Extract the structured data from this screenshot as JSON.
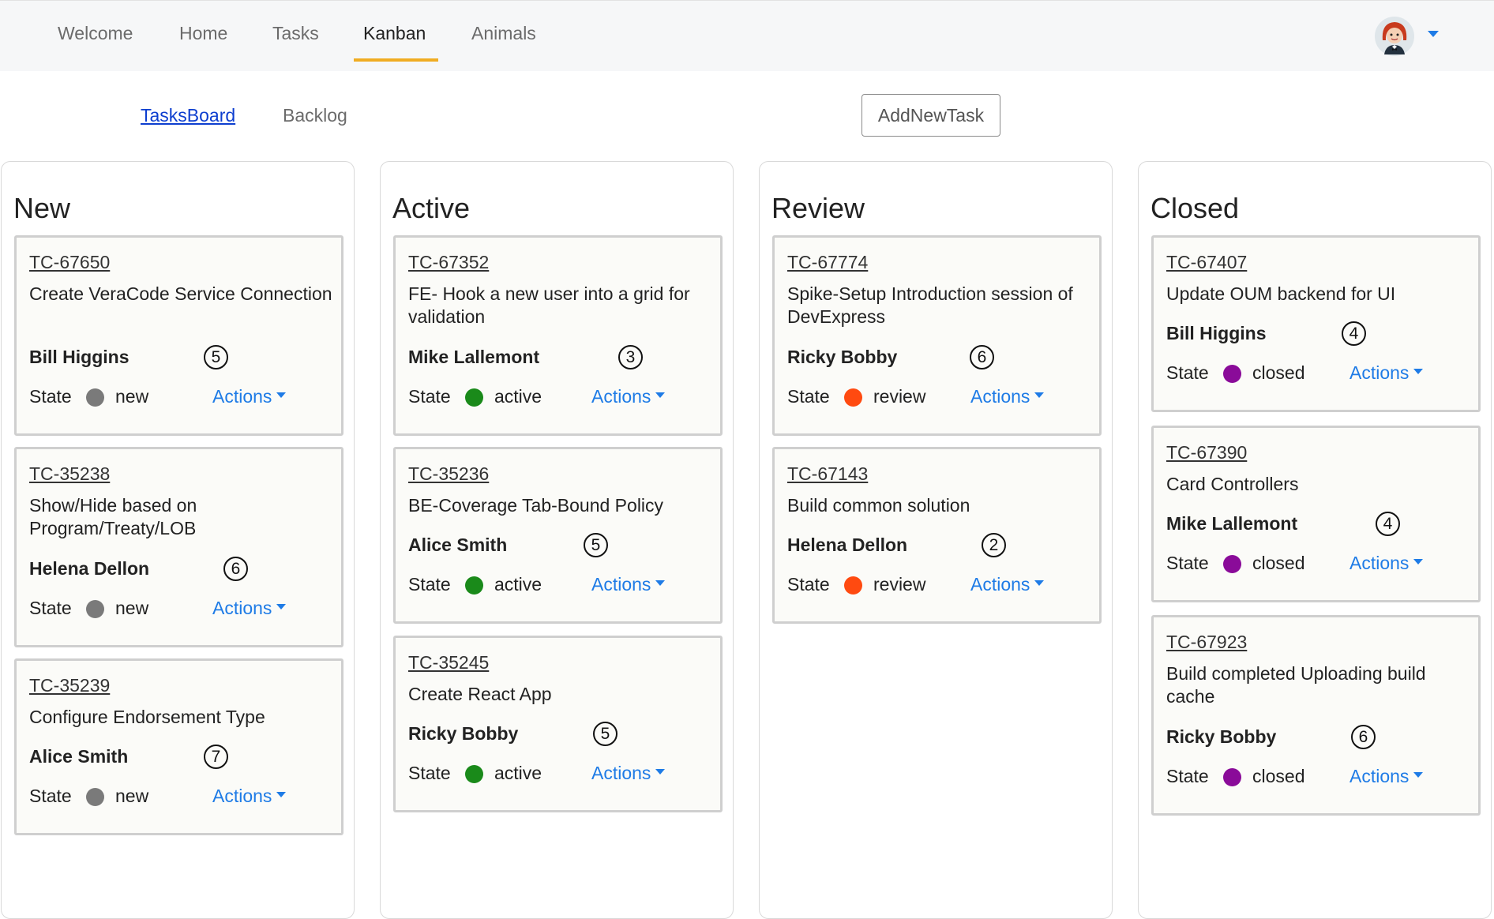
{
  "nav": {
    "links": [
      {
        "label": "Welcome",
        "active": false
      },
      {
        "label": "Home",
        "active": false
      },
      {
        "label": "Tasks",
        "active": false
      },
      {
        "label": "Kanban",
        "active": true
      },
      {
        "label": "Animals",
        "active": false
      }
    ],
    "accent_color": "#f0ad23",
    "avatar_icon": "user-avatar"
  },
  "subnav": {
    "taskboard_label": "TasksBoard",
    "backlog_label": "Backlog",
    "add_button_label": "AddNewTask"
  },
  "state_colors": {
    "new": "#7a7a7a",
    "active": "#1a8a1a",
    "review": "#ff4a10",
    "closed": "#8a0b99"
  },
  "columns": [
    {
      "title": "New",
      "cards": [
        {
          "id": "TC-67650",
          "title": "Create VeraCode Service Connection",
          "assignee": "Bill Higgins",
          "points": "5",
          "state_label": "State",
          "state": "new",
          "actions_label": "Actions"
        },
        {
          "id": "TC-35238",
          "title": "Show/Hide based on Program/Treaty/LOB",
          "assignee": "Helena Dellon",
          "points": "6",
          "state_label": "State",
          "state": "new",
          "actions_label": "Actions"
        },
        {
          "id": "TC-35239",
          "title": "Configure Endorsement Type",
          "assignee": "Alice Smith",
          "points": "7",
          "state_label": "State",
          "state": "new",
          "actions_label": "Actions"
        }
      ]
    },
    {
      "title": "Active",
      "cards": [
        {
          "id": "TC-67352",
          "title": "FE- Hook a new user into a grid for validation",
          "assignee": "Mike Lallemont",
          "points": "3",
          "state_label": "State",
          "state": "active",
          "actions_label": "Actions"
        },
        {
          "id": "TC-35236",
          "title": "BE-Coverage Tab-Bound Policy",
          "assignee": "Alice Smith",
          "points": "5",
          "state_label": "State",
          "state": "active",
          "actions_label": "Actions"
        },
        {
          "id": "TC-35245",
          "title": "Create React App",
          "assignee": "Ricky Bobby",
          "points": "5",
          "state_label": "State",
          "state": "active",
          "actions_label": "Actions"
        }
      ]
    },
    {
      "title": "Review",
      "cards": [
        {
          "id": "TC-67774",
          "title": "Spike-Setup Introduction session of DevExpress",
          "assignee": "Ricky Bobby",
          "points": "6",
          "state_label": "State",
          "state": "review",
          "actions_label": "Actions"
        },
        {
          "id": "TC-67143",
          "title": "Build common solution",
          "assignee": "Helena Dellon",
          "points": "2",
          "state_label": "State",
          "state": "review",
          "actions_label": "Actions"
        }
      ]
    },
    {
      "title": "Closed",
      "cards": [
        {
          "id": "TC-67407",
          "title": "Update OUM backend for UI",
          "assignee": "Bill Higgins",
          "points": "4",
          "state_label": "State",
          "state": "closed",
          "actions_label": "Actions"
        },
        {
          "id": "TC-67390",
          "title": "Card Controllers",
          "assignee": "Mike Lallemont",
          "points": "4",
          "state_label": "State",
          "state": "closed",
          "actions_label": "Actions"
        },
        {
          "id": "TC-67923",
          "title": "Build completed Uploading build cache",
          "assignee": "Ricky Bobby",
          "points": "6",
          "state_label": "State",
          "state": "closed",
          "actions_label": "Actions"
        }
      ]
    }
  ]
}
